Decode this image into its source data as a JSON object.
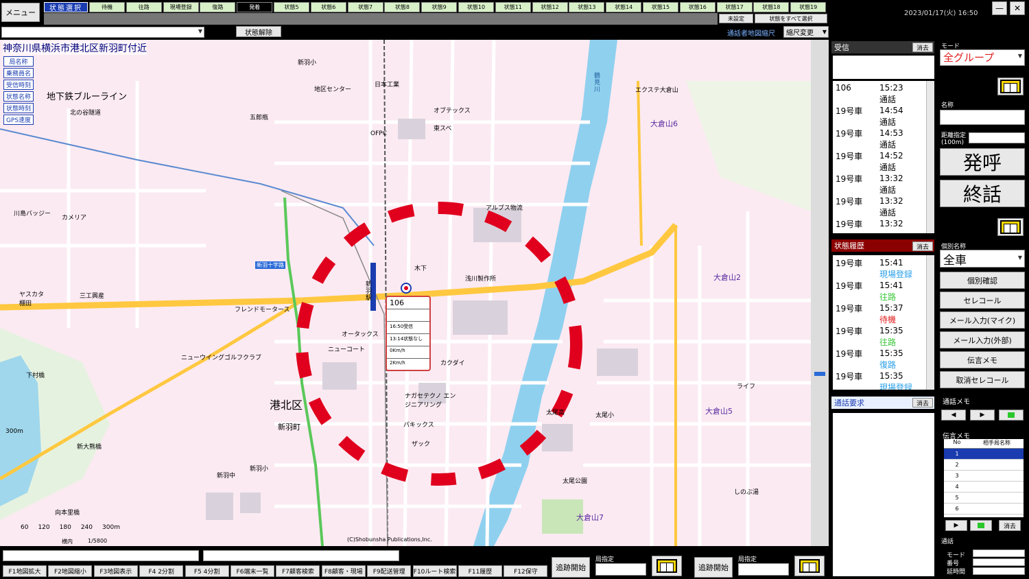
{
  "topbar": {
    "menu_label": "メニュー",
    "state_select_label": "状態選択",
    "state_buttons": [
      "待機",
      "往路",
      "現場登録",
      "復路",
      "発着",
      "状態5",
      "状態6",
      "状態7",
      "状態8",
      "状態9",
      "状態10",
      "状態11",
      "状態12",
      "状態13",
      "状態14",
      "状態15",
      "状態16",
      "状態17",
      "状態18",
      "状態19"
    ],
    "active_state": "発着",
    "unset_label": "未設定",
    "select_all_label": "状態をすべて選択",
    "datetime": "2023/01/17(火) 16:50",
    "minimize_label": "—",
    "close_label": "✕"
  },
  "toolbar": {
    "search_value": "",
    "release_label": "状態解除",
    "caller_map_label": "通話者地図縮尺",
    "scale_value": "縮尺変更"
  },
  "map": {
    "location_title": "神奈川県横浜市港北区新羽町付近",
    "legend_buttons": [
      "局名称",
      "乗務員名",
      "受信時刻",
      "状態名称",
      "状態時刻",
      "GPS速度"
    ],
    "labels": {
      "subway": "地下鉄ブルーライン",
      "kitayahara": "北の谷隧道",
      "ward": "港北区",
      "town": "新羽町",
      "okurayama2": "大倉山2",
      "okurayama5": "大倉山5",
      "okurayama6": "大倉山6",
      "okurayama7": "大倉山7",
      "station": "新羽駅",
      "tsurumigawa": "鶴見川",
      "copyright": "(C)Shobunsha Publications,Inc.",
      "scale_300": "300m",
      "scale_ratio": "1/5800",
      "scale_ticks": [
        "60",
        "120",
        "180",
        "240",
        "300m"
      ],
      "tokai": "横内",
      "park": "太尾公園",
      "ntdc": "エクステ大倉山",
      "alps": "アルプス物流",
      "asakawa": "浅川製作所",
      "kinoshita": "木下",
      "oaks": "オータックス",
      "newcort": "ニューコート",
      "kakugai": "カクダイ",
      "nakamura": "ナガセテクノ エンジニアリング",
      "pakisu": "パキックス",
      "zack": "ザック",
      "nitto": "日本工業",
      "ofukusu": "オブテックス",
      "tosuba": "東スベ",
      "ofpc": "OFPC",
      "niitsuboku": "新羽小",
      "kitanoushirotu": "地区センター",
      "kawashima": "川島バッジー",
      "kameria": "カメリア",
      "yasakata": "ヤスカタ 棚田",
      "mitoe": "三工興産",
      "friend": "フレンドモータース",
      "newwing": "ニューウイングゴルフクラブ",
      "shimokasashi": "下村橋",
      "shinyokoamacho": "新大熊橋",
      "mukaiishi": "向本里橋",
      "shinyu_chu": "新羽中",
      "shinyu_sho": "新羽小",
      "taio_ko": "太尾高",
      "taio_sho": "太尾小",
      "life": "ライフ",
      "shinoyu": "しのぶ湯",
      "goshomachi": "五郎瓶",
      "shinyujuji": "新羽十字路"
    }
  },
  "vehicle_popup": {
    "id": "106",
    "line2": "",
    "received": "16:50受信",
    "status": "13:14状態なし",
    "speed1": "0Km/h",
    "speed2": "2Km/h"
  },
  "received_panel": {
    "title": "受信",
    "clear_label": "消去",
    "rows": [
      {
        "id": "106",
        "time": "15:23",
        "status": "通話"
      },
      {
        "id": "19号車",
        "time": "14:54",
        "status": "通話"
      },
      {
        "id": "19号車",
        "time": "14:53",
        "status": "通話"
      },
      {
        "id": "19号車",
        "time": "14:52",
        "status": "通話"
      },
      {
        "id": "19号車",
        "time": "13:32",
        "status": "通話"
      },
      {
        "id": "19号車",
        "time": "13:32",
        "status": "通話"
      },
      {
        "id": "19号車",
        "time": "13:32",
        "status": ""
      }
    ]
  },
  "history_panel": {
    "title": "状態履歴",
    "clear_label": "消去",
    "rows": [
      {
        "id": "19号車",
        "time": "15:41",
        "status": "現場登録",
        "color": "#2aa0e8"
      },
      {
        "id": "19号車",
        "time": "15:41",
        "status": "往路",
        "color": "#3cc83c"
      },
      {
        "id": "19号車",
        "time": "15:37",
        "status": "待機",
        "color": "#e02020"
      },
      {
        "id": "19号車",
        "time": "15:35",
        "status": "往路",
        "color": "#3cc83c"
      },
      {
        "id": "19号車",
        "time": "15:35",
        "status": "復路",
        "color": "#2aa0e8"
      },
      {
        "id": "19号車",
        "time": "15:35",
        "status": "現場登録",
        "color": "#2aa0e8"
      }
    ]
  },
  "call_request_panel": {
    "title": "通話要求",
    "clear_label": "消去"
  },
  "side": {
    "mode_label": "モード",
    "mode_value": "全グループ",
    "name_label": "名称",
    "distance_label": "距離指定 (100m)",
    "call_label": "発呼",
    "end_label": "終話",
    "individual_label": "個別名称",
    "individual_value": "全車",
    "buttons": [
      "個別確認",
      "セレコール",
      "メール入力(マイク)",
      "メール入力(外部)",
      "伝言メモ",
      "取消セレコール"
    ],
    "call_memo_label": "通話メモ",
    "message_memo_label": "伝言メモ",
    "memo_headers": [
      "No",
      "相手局名称"
    ],
    "memo_rows": [
      "1",
      "2",
      "3",
      "4",
      "5",
      "6"
    ],
    "memo_clear_label": "消去",
    "call_label2": "通話",
    "mode2_label": "モード",
    "number_label": "番号",
    "extension_label": "延時間"
  },
  "fkeys": [
    "F1地図拡大",
    "F2地図縮小",
    "F3地図表示",
    "F4 2分割",
    "F5 4分割",
    "F6端末一覧",
    "F7顧客検索",
    "F8顧客・現場",
    "F9配送管理",
    "F10ルート検索",
    "F11履歴",
    "F12保守"
  ],
  "bottom": {
    "track_label": "追跡開始",
    "station_label": "局指定",
    "track_label2": "追跡開始",
    "station_label2": "局指定"
  },
  "colors": {
    "accent": "#1a3cb0",
    "history_head": "#8b0000",
    "circle": "#e0001e",
    "road": "#ffc840"
  }
}
